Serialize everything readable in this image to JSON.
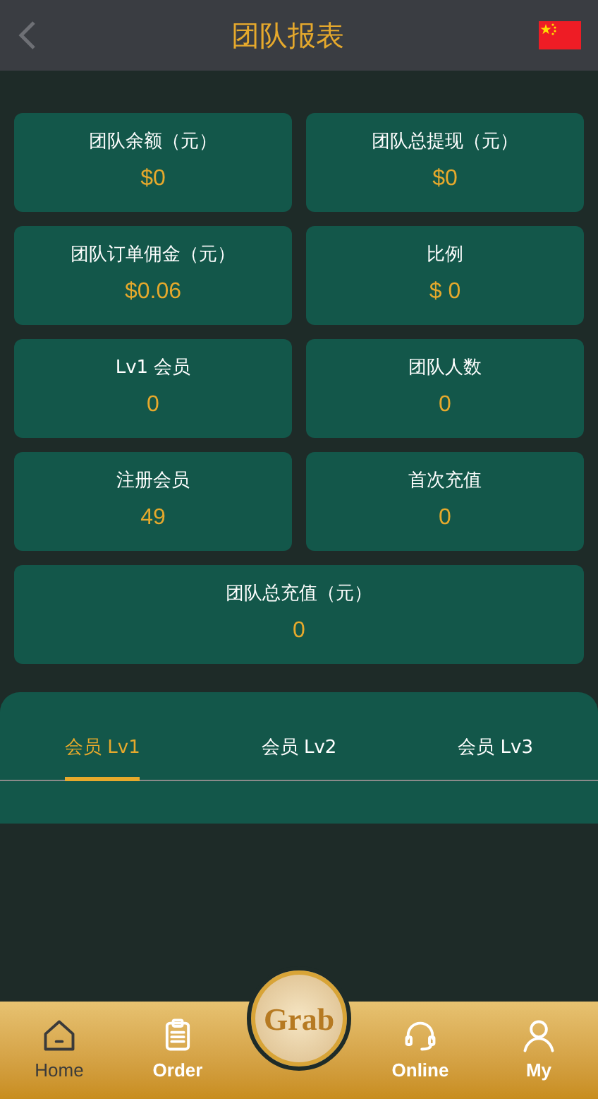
{
  "header": {
    "title": "团队报表"
  },
  "stats": [
    {
      "label": "团队余额（元）",
      "value": "$0"
    },
    {
      "label": "团队总提现（元）",
      "value": "$0"
    },
    {
      "label": "团队订单佣金（元）",
      "value": "$0.06"
    },
    {
      "label": "比例",
      "value": "$ 0"
    },
    {
      "label": "Lv1 会员",
      "value": "0"
    },
    {
      "label": "团队人数",
      "value": "0"
    },
    {
      "label": "注册会员",
      "value": "49"
    },
    {
      "label": "首次充值",
      "value": "0"
    },
    {
      "label": "团队总充值（元）",
      "value": "0"
    }
  ],
  "tabs": [
    {
      "label": "会员 Lv1",
      "selected": true
    },
    {
      "label": "会员 Lv2",
      "selected": false
    },
    {
      "label": "会员 Lv3",
      "selected": false
    }
  ],
  "nav": {
    "center": "Grab",
    "items": [
      {
        "kind": "home",
        "label": "Home",
        "selected": true
      },
      {
        "kind": "order",
        "label": "Order",
        "selected": false
      },
      {
        "kind": "online",
        "label": "Online",
        "selected": false
      },
      {
        "kind": "my",
        "label": "My",
        "selected": false
      }
    ]
  }
}
